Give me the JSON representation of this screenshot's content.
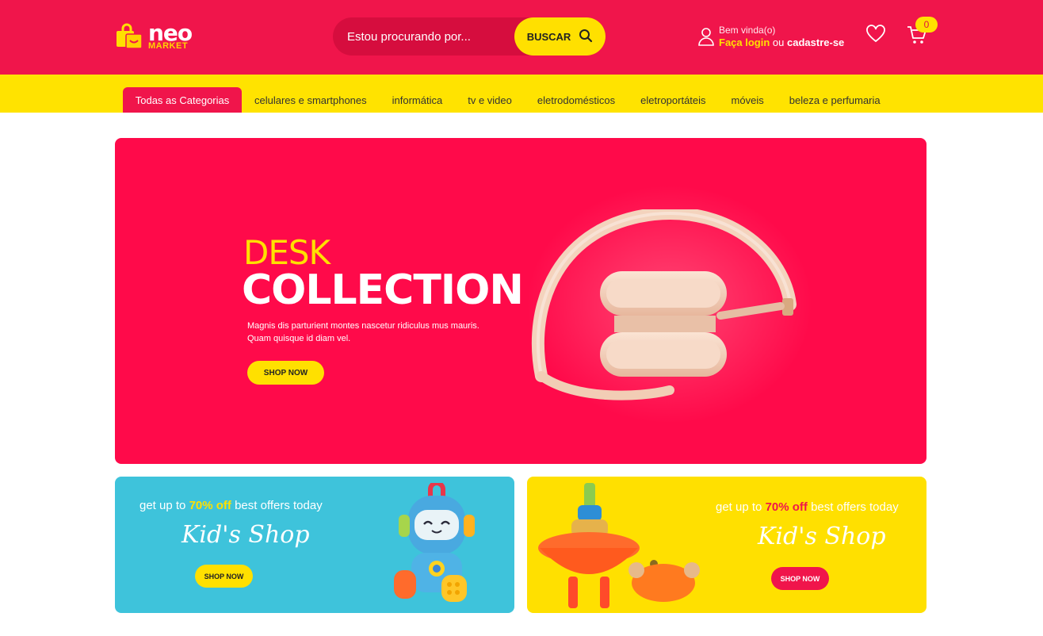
{
  "header": {
    "logo": {
      "name": "neo",
      "tagline": "MARKET"
    },
    "search": {
      "placeholder": "Estou procurando por...",
      "button_label": "BUSCAR"
    },
    "account": {
      "welcome": "Bem vinda(o)",
      "login_label": "Faça login",
      "or_label": "ou",
      "register_label": "cadastre-se"
    },
    "cart": {
      "count": "0"
    }
  },
  "categories": {
    "all_label": "Todas as Categorias",
    "items": [
      {
        "label": "celulares e smartphones"
      },
      {
        "label": "informática"
      },
      {
        "label": "tv e video"
      },
      {
        "label": "eletrodomésticos"
      },
      {
        "label": "eletroportáteis"
      },
      {
        "label": "móveis"
      },
      {
        "label": "beleza e perfumaria"
      }
    ]
  },
  "hero": {
    "title_line1": "DESK",
    "title_line2": "COLLECTION",
    "description": "Magnis dis parturient montes nascetur ridiculus mus mauris. Quam quisque id diam vel.",
    "button_label": "SHOP NOW"
  },
  "promos": [
    {
      "offer_prefix": "get up to",
      "offer_highlight": "70% off",
      "offer_suffix": "best offers today",
      "title": "Kid's Shop",
      "button_label": "SHOP NOW"
    },
    {
      "offer_prefix": "get up to",
      "offer_highlight": "70% off",
      "offer_suffix": "best offers today",
      "title": "Kid's Shop",
      "button_label": "SHOP NOW"
    }
  ],
  "colors": {
    "primary_red": "#f0154b",
    "accent_yellow": "#ffe000",
    "promo_blue": "#3ec3db",
    "hero_red": "#ff0a4a"
  },
  "icons": {
    "logo": "shopping-bag-icon",
    "search": "search-icon",
    "account": "user-icon",
    "wishlist": "heart-icon",
    "cart": "cart-icon"
  }
}
